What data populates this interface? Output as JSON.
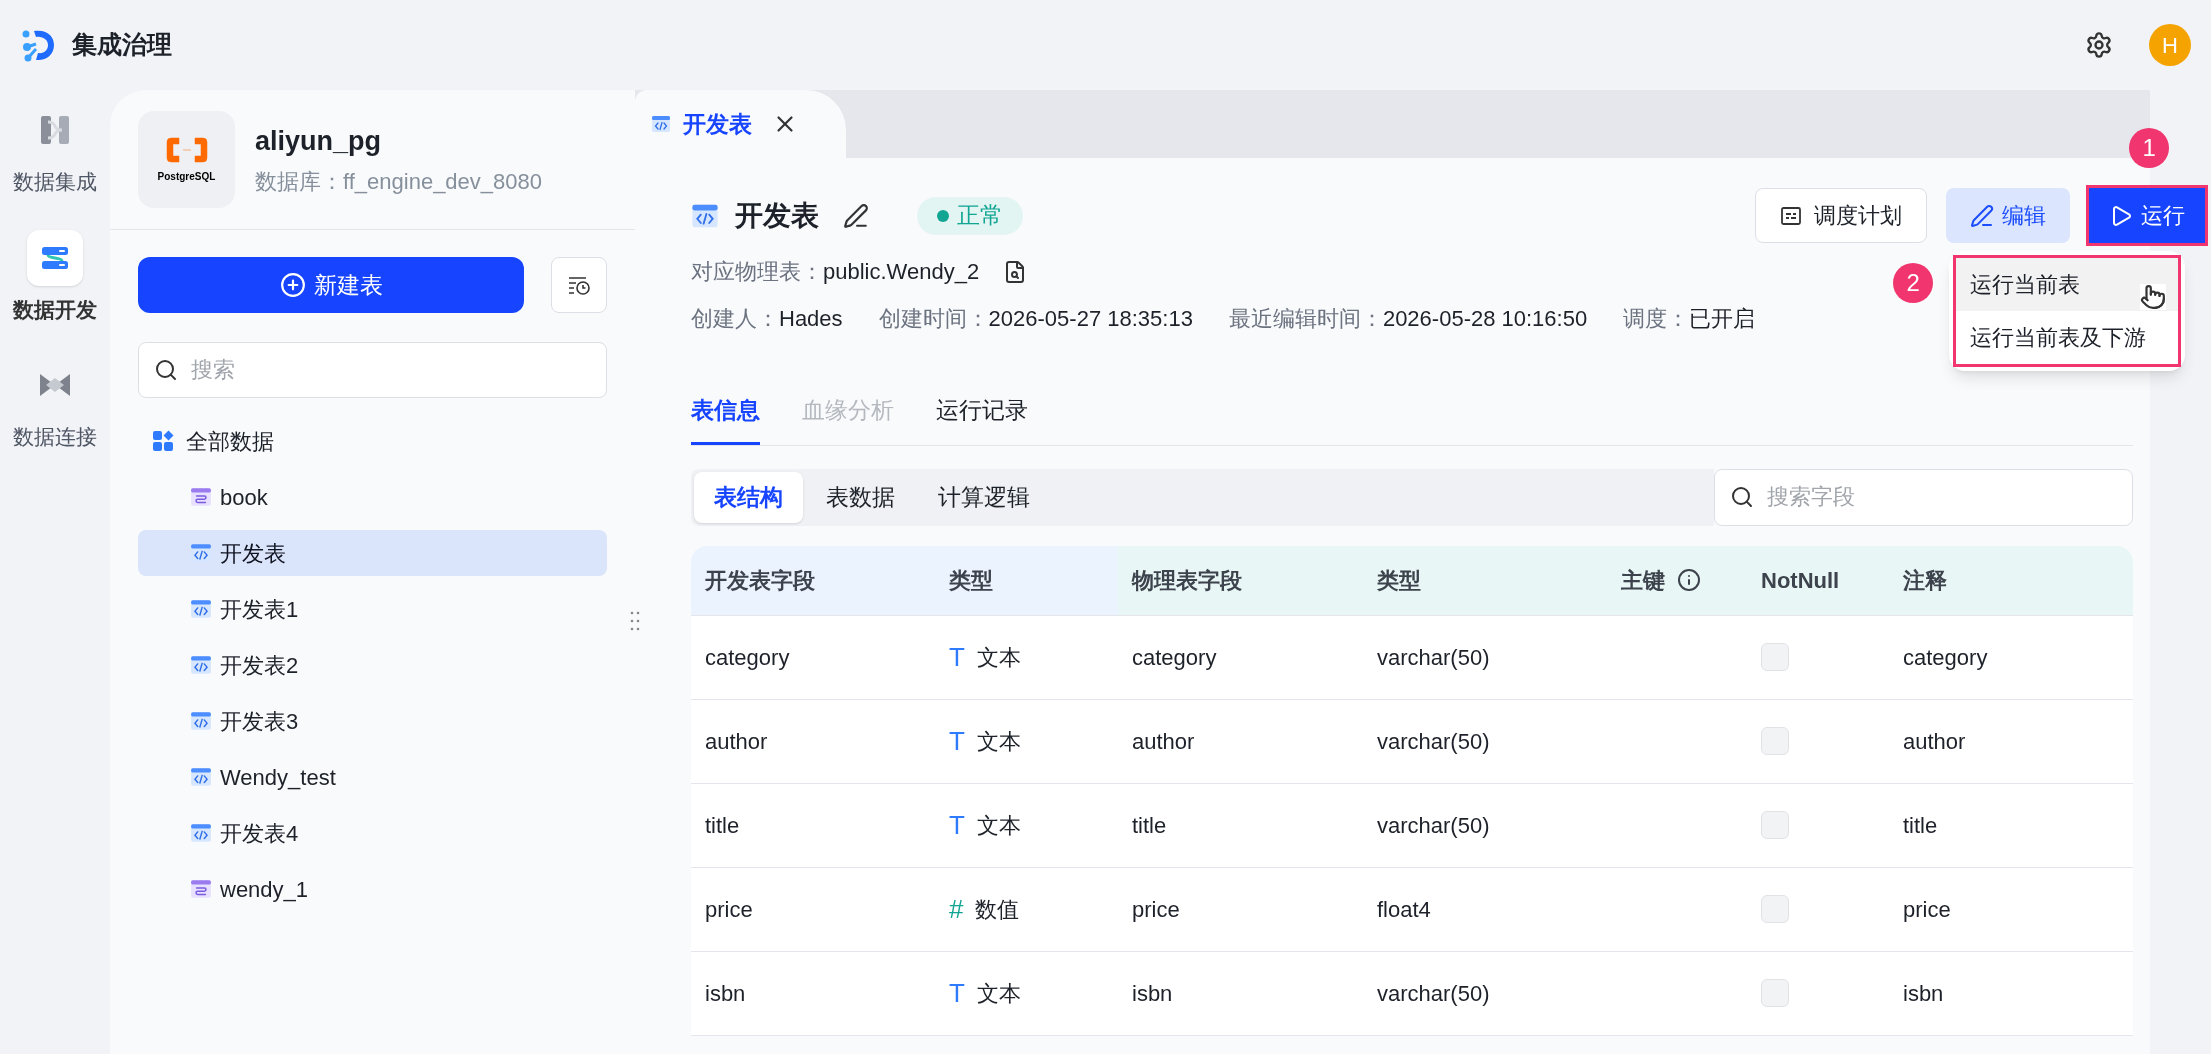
{
  "app": {
    "title": "集成治理",
    "avatar": "H"
  },
  "nav": [
    {
      "label": "数据集成",
      "kind": "integrate",
      "selected": false
    },
    {
      "label": "数据开发",
      "kind": "develop",
      "selected": true
    },
    {
      "label": "数据连接",
      "kind": "connect",
      "selected": false
    }
  ],
  "datasource": {
    "logo": "PostgreSQL",
    "name": "aliyun_pg",
    "database": "数据库：ff_engine_dev_8080"
  },
  "sidebar": {
    "new_button": "新建表",
    "search": {
      "placeholder": "搜索"
    },
    "tree": {
      "label": "全部数据",
      "children": [
        {
          "label": "book",
          "kind": "physical",
          "selected": false
        },
        {
          "label": "开发表",
          "kind": "dev",
          "selected": true
        },
        {
          "label": "开发表1",
          "kind": "dev",
          "selected": false
        },
        {
          "label": "开发表2",
          "kind": "dev",
          "selected": false
        },
        {
          "label": "开发表3",
          "kind": "dev",
          "selected": false
        },
        {
          "label": "Wendy_test",
          "kind": "dev",
          "selected": false
        },
        {
          "label": "开发表4",
          "kind": "dev",
          "selected": false
        },
        {
          "label": "wendy_1",
          "kind": "physical",
          "selected": false
        }
      ]
    }
  },
  "tabs": [
    {
      "label": "开发表",
      "selected": true
    }
  ],
  "detail": {
    "title": "开发表",
    "status": "正常",
    "buttons": [
      {
        "label": "调度计划",
        "kind": "schedule"
      },
      {
        "label": "编辑",
        "kind": "edit"
      },
      {
        "label": "运行",
        "kind": "run",
        "highlighted": true,
        "callout": "1"
      }
    ],
    "run_menu": {
      "callout": "2",
      "items": [
        {
          "label": "运行当前表",
          "hovered": true
        },
        {
          "label": "运行当前表及下游",
          "hovered": false
        }
      ]
    },
    "physical_table": {
      "label": "对应物理表：",
      "value": "public.Wendy_2"
    },
    "meta": [
      {
        "label": "创建人：",
        "value": "Hades"
      },
      {
        "label": "创建时间：",
        "value": "2026-05-27 18:35:13"
      },
      {
        "label": "最近编辑时间：",
        "value": "2026-05-28 10:16:50"
      },
      {
        "label": "调度：",
        "value": "已开启"
      }
    ]
  },
  "info_tabs": [
    {
      "label": "表信息",
      "selected": true,
      "disabled": false
    },
    {
      "label": "血缘分析",
      "selected": false,
      "disabled": true
    },
    {
      "label": "运行记录",
      "selected": false,
      "disabled": false
    }
  ],
  "sub_tabs": [
    {
      "label": "表结构",
      "selected": true
    },
    {
      "label": "表数据",
      "selected": false
    },
    {
      "label": "计算逻辑",
      "selected": false
    }
  ],
  "field_search": {
    "placeholder": "搜索字段"
  },
  "table": {
    "columns": [
      {
        "label": "开发表字段",
        "kind": "dev"
      },
      {
        "label": "类型",
        "kind": "dev"
      },
      {
        "label": "物理表字段",
        "kind": "physical"
      },
      {
        "label": "类型",
        "kind": "physical"
      },
      {
        "label": "主键",
        "kind": "physical",
        "info": true
      },
      {
        "label": "NotNull",
        "kind": "physical"
      },
      {
        "label": "注释",
        "kind": "physical"
      }
    ],
    "rows": [
      {
        "field": "category",
        "type": {
          "kind": "text",
          "glyph": "T",
          "label": "文本"
        },
        "physical_field": "category",
        "physical_type": "varchar(50)",
        "not_null": false,
        "comment": "category"
      },
      {
        "field": "author",
        "type": {
          "kind": "text",
          "glyph": "T",
          "label": "文本"
        },
        "physical_field": "author",
        "physical_type": "varchar(50)",
        "not_null": false,
        "comment": "author"
      },
      {
        "field": "title",
        "type": {
          "kind": "text",
          "glyph": "T",
          "label": "文本"
        },
        "physical_field": "title",
        "physical_type": "varchar(50)",
        "not_null": false,
        "comment": "title"
      },
      {
        "field": "price",
        "type": {
          "kind": "number",
          "glyph": "#",
          "label": "数值"
        },
        "physical_field": "price",
        "physical_type": "float4",
        "not_null": false,
        "comment": "price"
      },
      {
        "field": "isbn",
        "type": {
          "kind": "text",
          "glyph": "T",
          "label": "文本"
        },
        "physical_field": "isbn",
        "physical_type": "varchar(50)",
        "not_null": false,
        "comment": "isbn"
      }
    ]
  }
}
